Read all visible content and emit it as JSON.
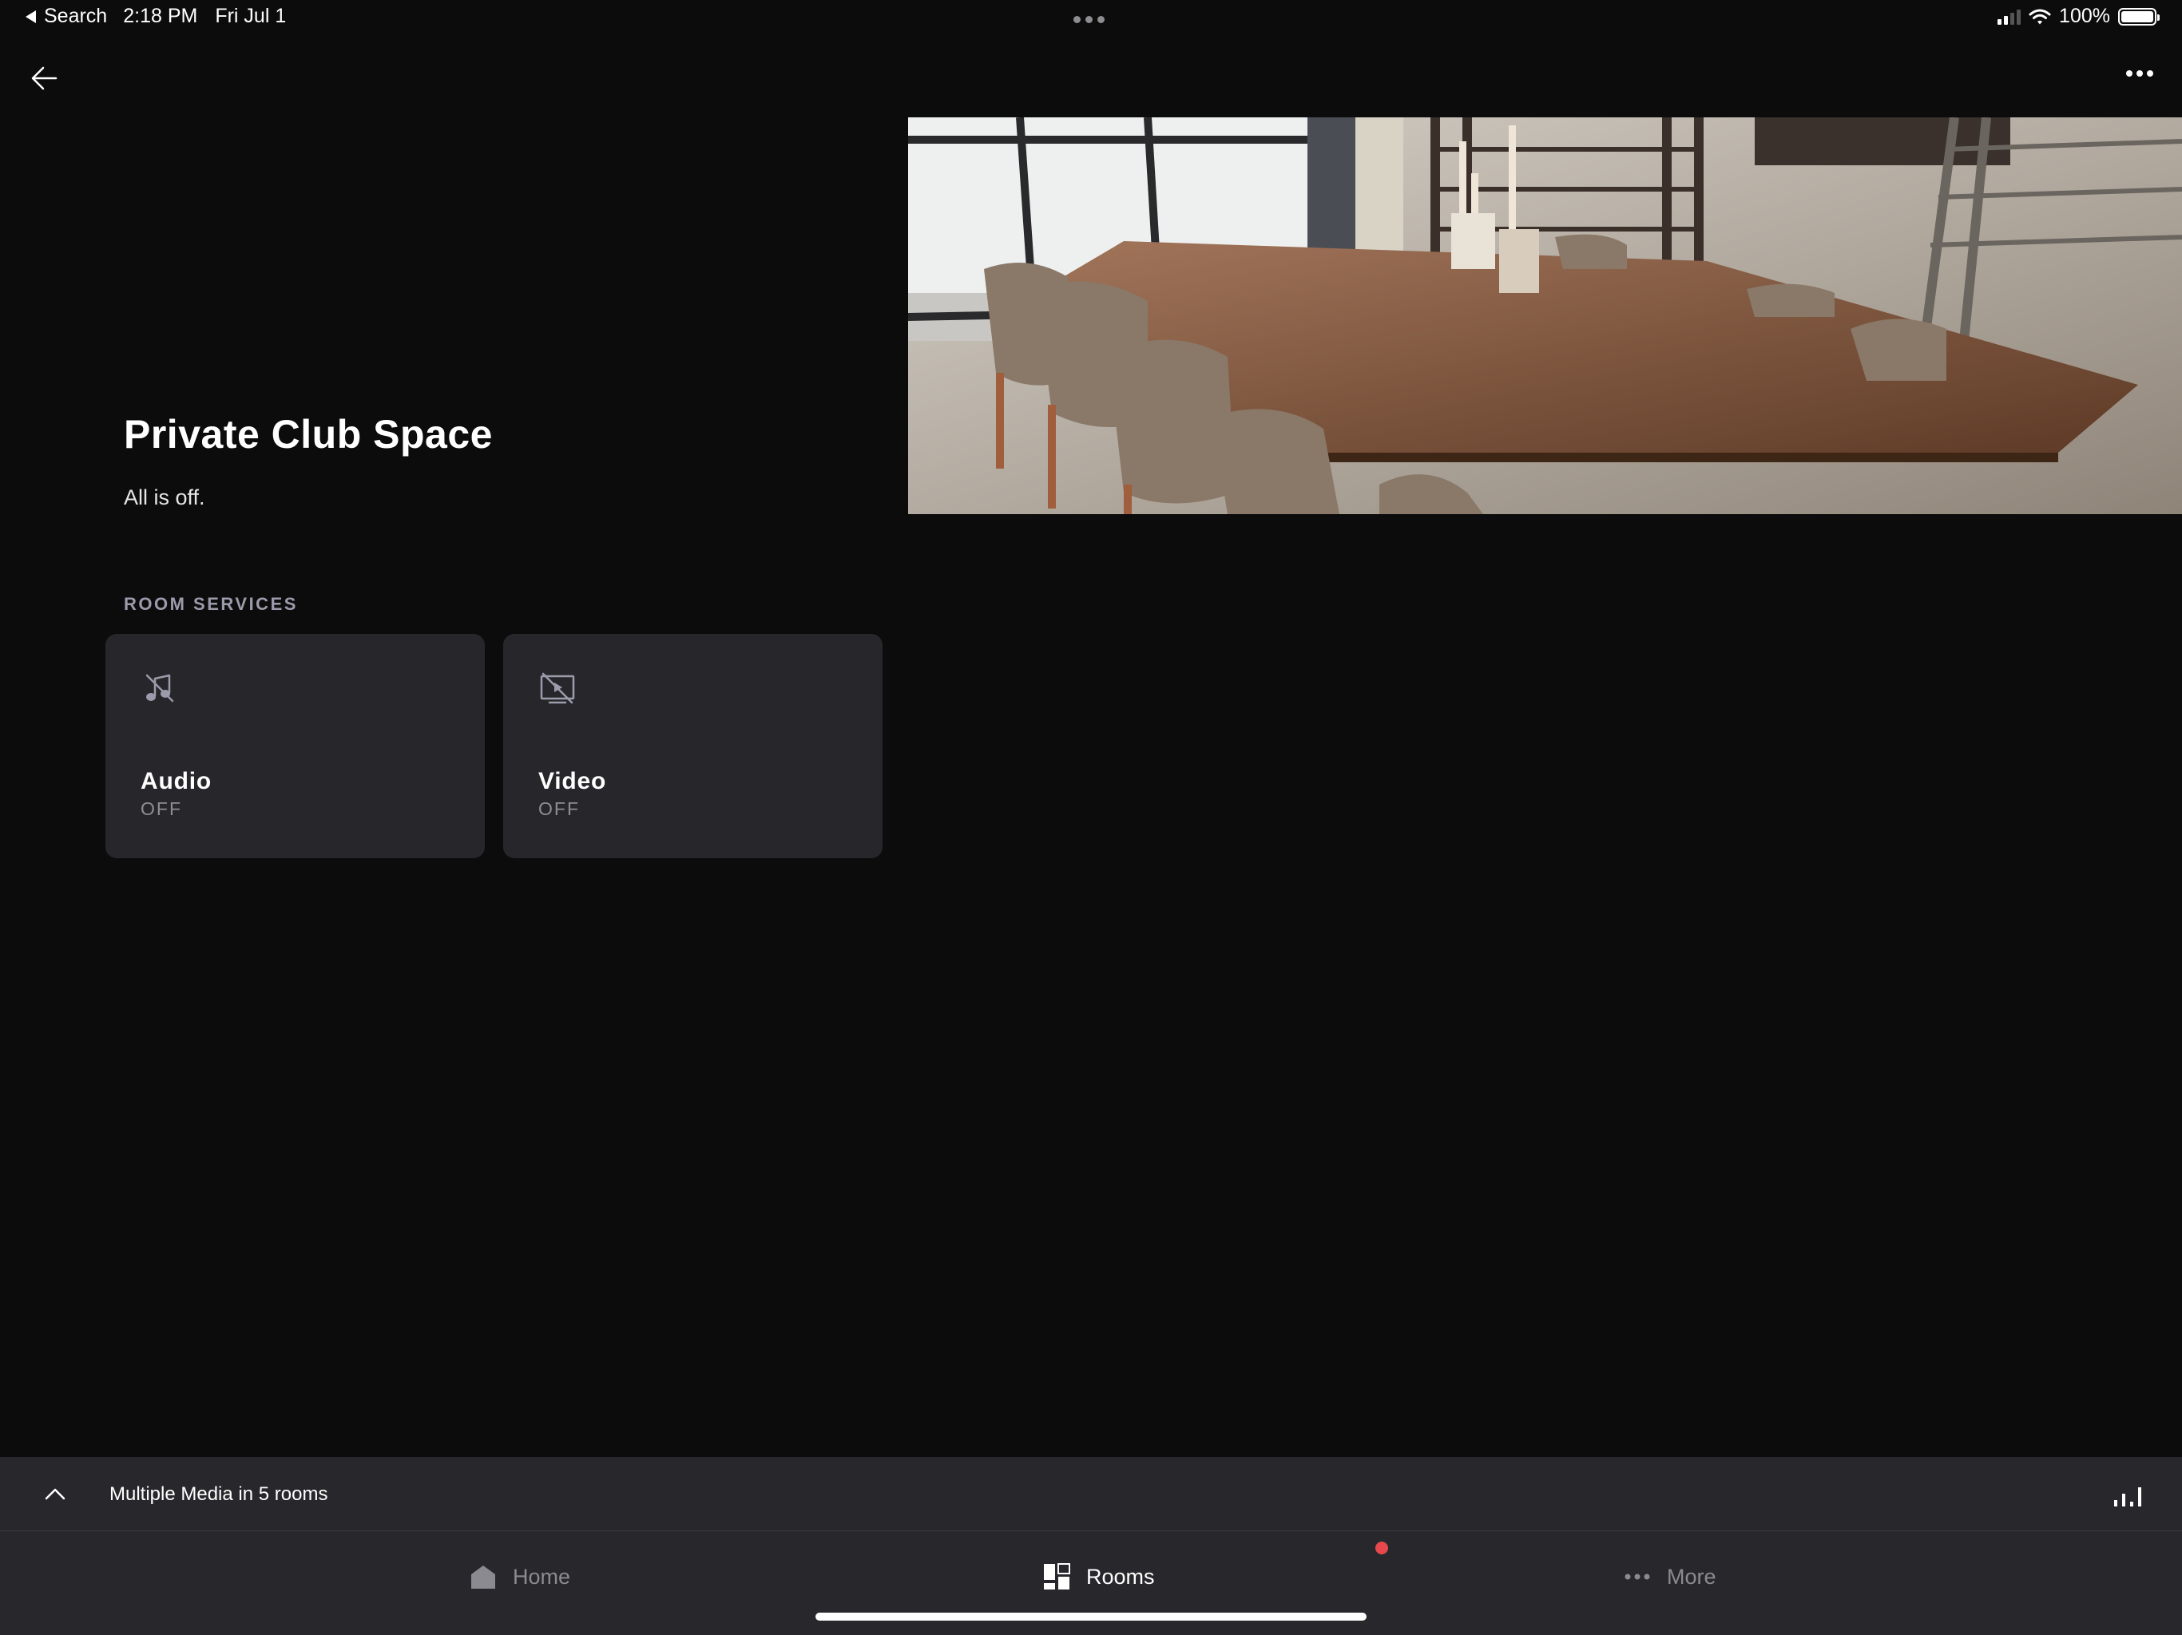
{
  "status_bar": {
    "back_app": "Search",
    "time": "2:18 PM",
    "date": "Fri Jul 1",
    "battery": "100%"
  },
  "room": {
    "title": "Private Club Space",
    "status": "All is off."
  },
  "services": {
    "section_label": "ROOM SERVICES",
    "items": [
      {
        "name": "Audio",
        "state": "OFF",
        "icon": "music-off-icon"
      },
      {
        "name": "Video",
        "state": "OFF",
        "icon": "display-off-icon"
      }
    ]
  },
  "media_bar": {
    "text": "Multiple Media in 5 rooms"
  },
  "tabs": [
    {
      "label": "Home",
      "icon": "home-icon",
      "active": false
    },
    {
      "label": "Rooms",
      "icon": "rooms-grid-icon",
      "active": true
    },
    {
      "label": "More",
      "icon": "more-dots-icon",
      "active": false
    }
  ],
  "colors": {
    "background": "#0c0c0d",
    "tile": "#27272b",
    "bar": "#28282c",
    "label_muted": "#9b9bab",
    "notification": "#e5484d"
  }
}
